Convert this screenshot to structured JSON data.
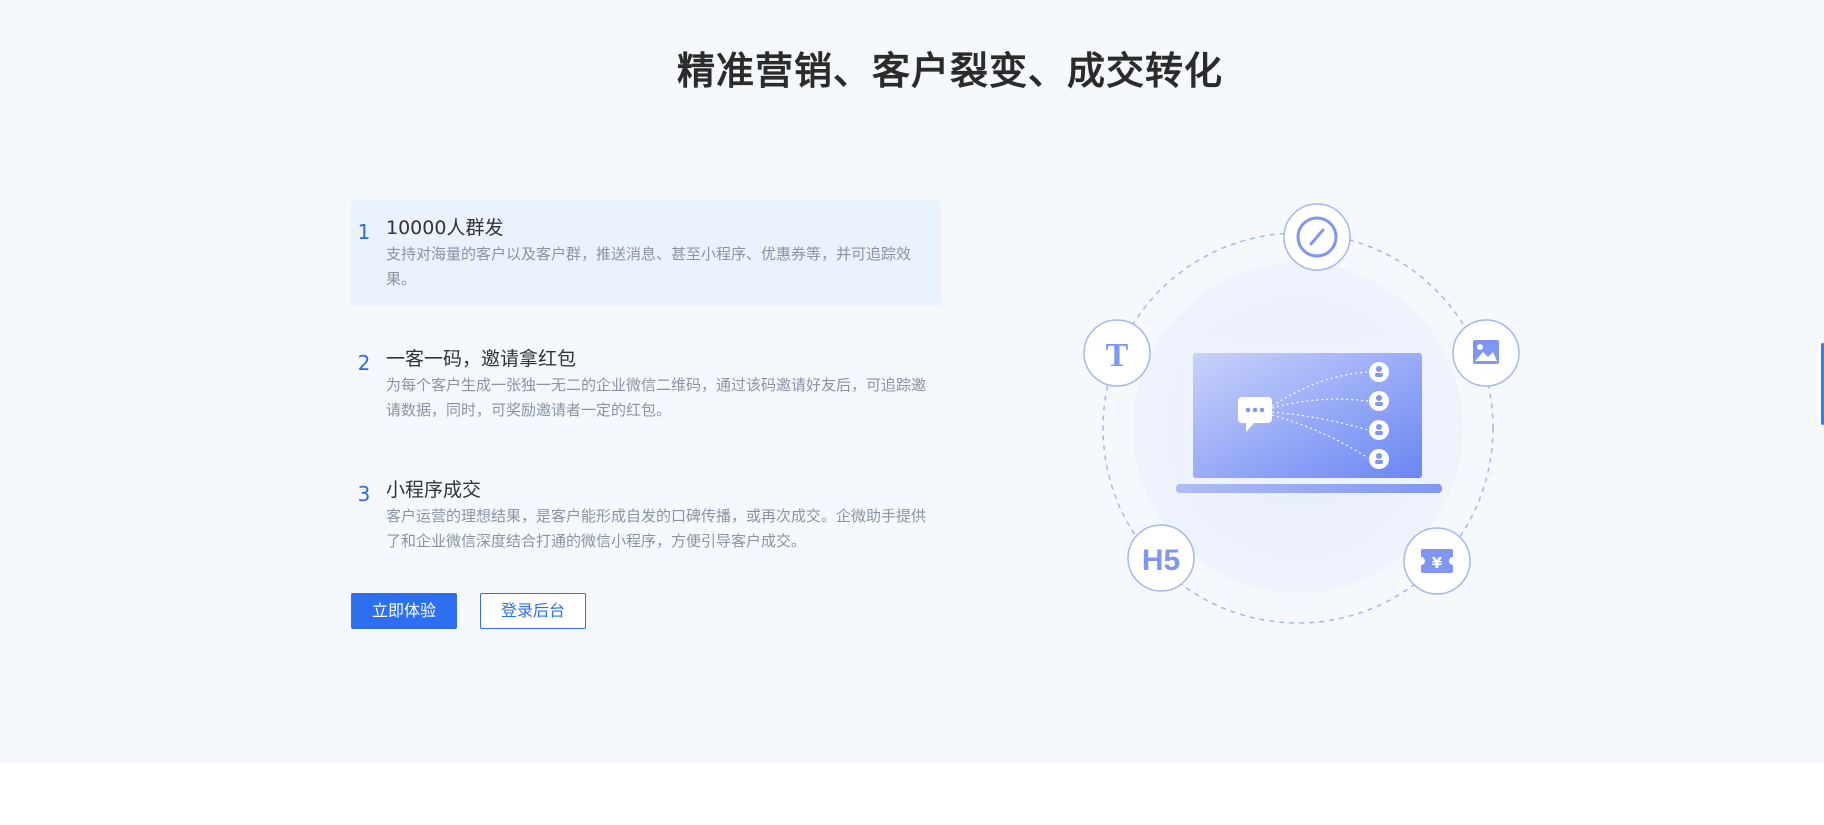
{
  "title": "精准营销、客户裂变、成交转化",
  "features": [
    {
      "num": "1",
      "title": "10000人群发",
      "desc": "支持对海量的客户以及客户群，推送消息、甚至小程序、优惠券等，并可追踪效果。"
    },
    {
      "num": "2",
      "title": "一客一码，邀请拿红包",
      "desc": "为每个客户生成一张独一无二的企业微信二维码，通过该码邀请好友后，可追踪邀请数据，同时，可奖励邀请者一定的红包。"
    },
    {
      "num": "3",
      "title": "小程序成交",
      "desc": "客户运营的理想结果，是客户能形成自发的口碑传播，或再次成交。企微助手提供了和企业微信深度结合打通的微信小程序，方便引导客户成交。"
    }
  ],
  "buttons": {
    "try": "立即体验",
    "login": "登录后台"
  },
  "illustration": {
    "icons": [
      "link-icon",
      "text-icon",
      "image-icon",
      "h5-icon",
      "coupon-icon"
    ],
    "icon_text": {
      "text": "T",
      "h5": "H5",
      "coupon": "¥"
    },
    "colors": {
      "accent": "#2e6ff0",
      "ring": "#a6b6f0",
      "screen_start": "#c9d2fb",
      "screen_end": "#6a86f3"
    }
  }
}
